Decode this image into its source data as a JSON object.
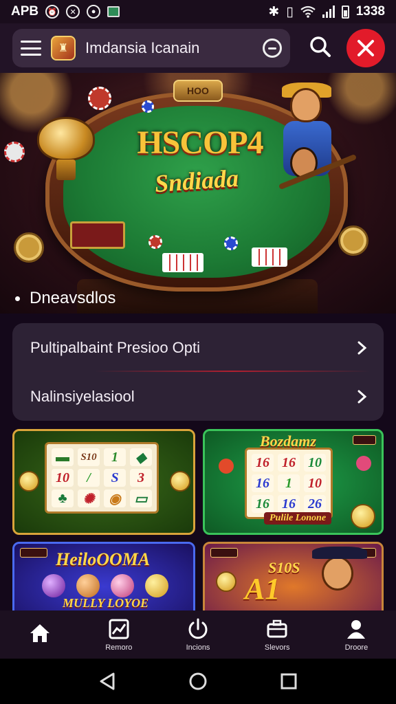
{
  "status_bar": {
    "left_text": "APB",
    "time": "1338",
    "icons": [
      "alarm-icon",
      "timer-icon",
      "dnd-icon",
      "notification-icon",
      "bluetooth-icon",
      "vibrate-icon",
      "wifi-icon",
      "signal-icon",
      "battery-icon"
    ]
  },
  "app_bar": {
    "title": "Imdansia Icanain",
    "icons": {
      "menu": "menu-icon",
      "logo": "app-logo-icon",
      "history": "clock-icon",
      "search": "search-icon",
      "close": "close-icon"
    },
    "close_color": "#e21b2a"
  },
  "hero": {
    "plaque": "HOO",
    "title": "HSCOP4",
    "subtitle": "Sndiada"
  },
  "section": {
    "label": "Dneavsdlos"
  },
  "menu": {
    "items": [
      {
        "label": "Pultipalbaint Presioo Opti"
      },
      {
        "label": "Nalinsiyelasiool"
      }
    ]
  },
  "games": [
    {
      "reels": [
        [
          "",
          "10",
          ""
        ],
        [
          "S10",
          "",
          ""
        ],
        [
          "1",
          "S",
          ""
        ],
        [
          "",
          "3",
          ""
        ]
      ]
    },
    {
      "banner": "Bozdamz",
      "tag": "",
      "reels": [
        [
          "16",
          "16",
          "16"
        ],
        [
          "16",
          "1",
          "16"
        ],
        [
          "10",
          "10",
          "26"
        ]
      ],
      "footer": "Pulile Lonone"
    },
    {
      "banner": "HeiloOOMA",
      "sub": "MULLY LOYOE"
    },
    {
      "banner": "S10S",
      "big": "A1"
    }
  ],
  "bottom_nav": {
    "items": [
      {
        "label": "",
        "icon": "home-icon"
      },
      {
        "label": "Remoro",
        "icon": "chart-icon"
      },
      {
        "label": "Incions",
        "icon": "power-icon"
      },
      {
        "label": "Slevors",
        "icon": "briefcase-icon"
      },
      {
        "label": "Droore",
        "icon": "profile-icon"
      }
    ]
  },
  "system_nav": {
    "icons": [
      "back-icon",
      "home-circle-icon",
      "recents-icon"
    ]
  }
}
